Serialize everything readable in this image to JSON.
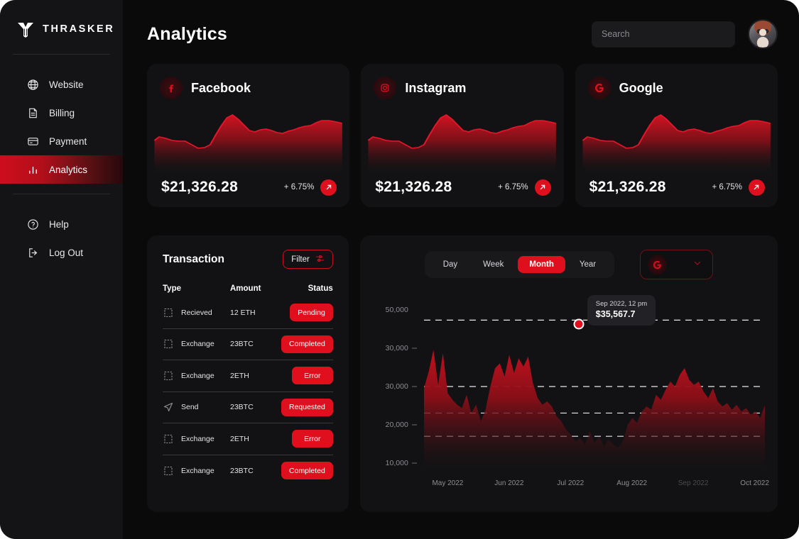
{
  "brand": {
    "name": "THRASKER",
    "logo_icon": "thrasker-logo-icon"
  },
  "sidebar": {
    "items": [
      {
        "label": "Website",
        "icon": "globe-icon",
        "active": false
      },
      {
        "label": "Billing",
        "icon": "document-icon",
        "active": false
      },
      {
        "label": "Payment",
        "icon": "credit-card-icon",
        "active": false
      },
      {
        "label": "Analytics",
        "icon": "bar-chart-icon",
        "active": true
      }
    ],
    "footer_items": [
      {
        "label": "Help",
        "icon": "help-circle-icon"
      },
      {
        "label": "Log Out",
        "icon": "logout-icon"
      }
    ]
  },
  "header": {
    "title": "Analytics",
    "search": {
      "placeholder": "Search",
      "value": ""
    },
    "avatar_icon": "user-avatar"
  },
  "stat_cards": [
    {
      "brand": "Facebook",
      "icon": "facebook-icon",
      "amount": "$21,326.28",
      "delta": "+ 6.75%",
      "delta_icon": "arrow-up-right-icon"
    },
    {
      "brand": "Instagram",
      "icon": "instagram-icon",
      "amount": "$21,326.28",
      "delta": "+ 6.75%",
      "delta_icon": "arrow-up-right-icon"
    },
    {
      "brand": "Google",
      "icon": "google-icon",
      "amount": "$21,326.28",
      "delta": "+ 6.75%",
      "delta_icon": "arrow-up-right-icon"
    }
  ],
  "transactions": {
    "title": "Transaction",
    "filter_label": "Filter",
    "filter_icon": "sliders-icon",
    "columns": [
      "Type",
      "Amount",
      "Status"
    ],
    "rows": [
      {
        "type": "Recieved",
        "icon": "download-icon",
        "amount": "12 ETH",
        "status": "Pending"
      },
      {
        "type": "Exchange",
        "icon": "exchange-icon",
        "amount": "23BTC",
        "status": "Completed"
      },
      {
        "type": "Exchange",
        "icon": "exchange-icon",
        "amount": "2ETH",
        "status": "Error"
      },
      {
        "type": "Send",
        "icon": "send-icon",
        "amount": "23BTC",
        "status": "Requested"
      },
      {
        "type": "Exchange",
        "icon": "exchange-icon",
        "amount": "2ETH",
        "status": "Error"
      },
      {
        "type": "Exchange",
        "icon": "exchange-icon",
        "amount": "23BTC",
        "status": "Completed"
      }
    ]
  },
  "chart_panel": {
    "range_tabs": [
      {
        "label": "Day",
        "active": false
      },
      {
        "label": "Week",
        "active": false
      },
      {
        "label": "Month",
        "active": true
      },
      {
        "label": "Year",
        "active": false
      }
    ],
    "source_select": {
      "value": "Google",
      "icon": "google-icon",
      "chevron": "chevron-down-icon"
    },
    "tooltip": {
      "time": "Sep 2022, 12 pm",
      "value": "$35,567.7"
    }
  },
  "colors": {
    "accent": "#e00f1e",
    "accent_dark": "#8c0d16",
    "panel": "#121214",
    "page_bg": "#0a0a0b",
    "sidebar_bg": "#141416",
    "text": "#ffffff",
    "muted": "#8d8d93"
  },
  "chart_data": {
    "type": "area",
    "title": "",
    "xlabel": "",
    "ylabel": "",
    "x_tick_labels": [
      "May 2022",
      "Jun 2022",
      "Jul 2022",
      "Aug 2022",
      "Sep 2022",
      "Oct 2022"
    ],
    "y_tick_labels": [
      "50,000",
      "30,000",
      "30,000",
      "20,000",
      "10,000"
    ],
    "y_tick_values": [
      50000,
      30000,
      30000,
      20000,
      10000
    ],
    "ylim": [
      5000,
      55000
    ],
    "grid": "dashed-horizontal",
    "legend": "none",
    "highlight_point": {
      "x_label": "Sep 2022",
      "time": "12 pm",
      "value": 35567.7,
      "value_label": "$35,567.7"
    },
    "values": [
      29500,
      34500,
      41000,
      30500,
      40000,
      28000,
      26000,
      24500,
      23500,
      27500,
      22000,
      24500,
      19500,
      23000,
      30000,
      35500,
      37000,
      33000,
      39500,
      34000,
      38500,
      36000,
      39000,
      31000,
      26500,
      24500,
      25500,
      24000,
      21000,
      19500,
      17000,
      15500,
      13500,
      14500,
      12500,
      16500,
      13000,
      15000,
      12000,
      14000,
      12500,
      11500,
      13500,
      18500,
      20500,
      19000,
      22500,
      24000,
      23000,
      27500,
      26000,
      29000,
      31500,
      30000,
      33500,
      35567.7,
      32000,
      30500,
      31500,
      28500,
      26500,
      29500,
      25500,
      24000,
      25000,
      23000,
      24500,
      22500,
      23500,
      21500,
      22500,
      20500,
      24500
    ]
  }
}
